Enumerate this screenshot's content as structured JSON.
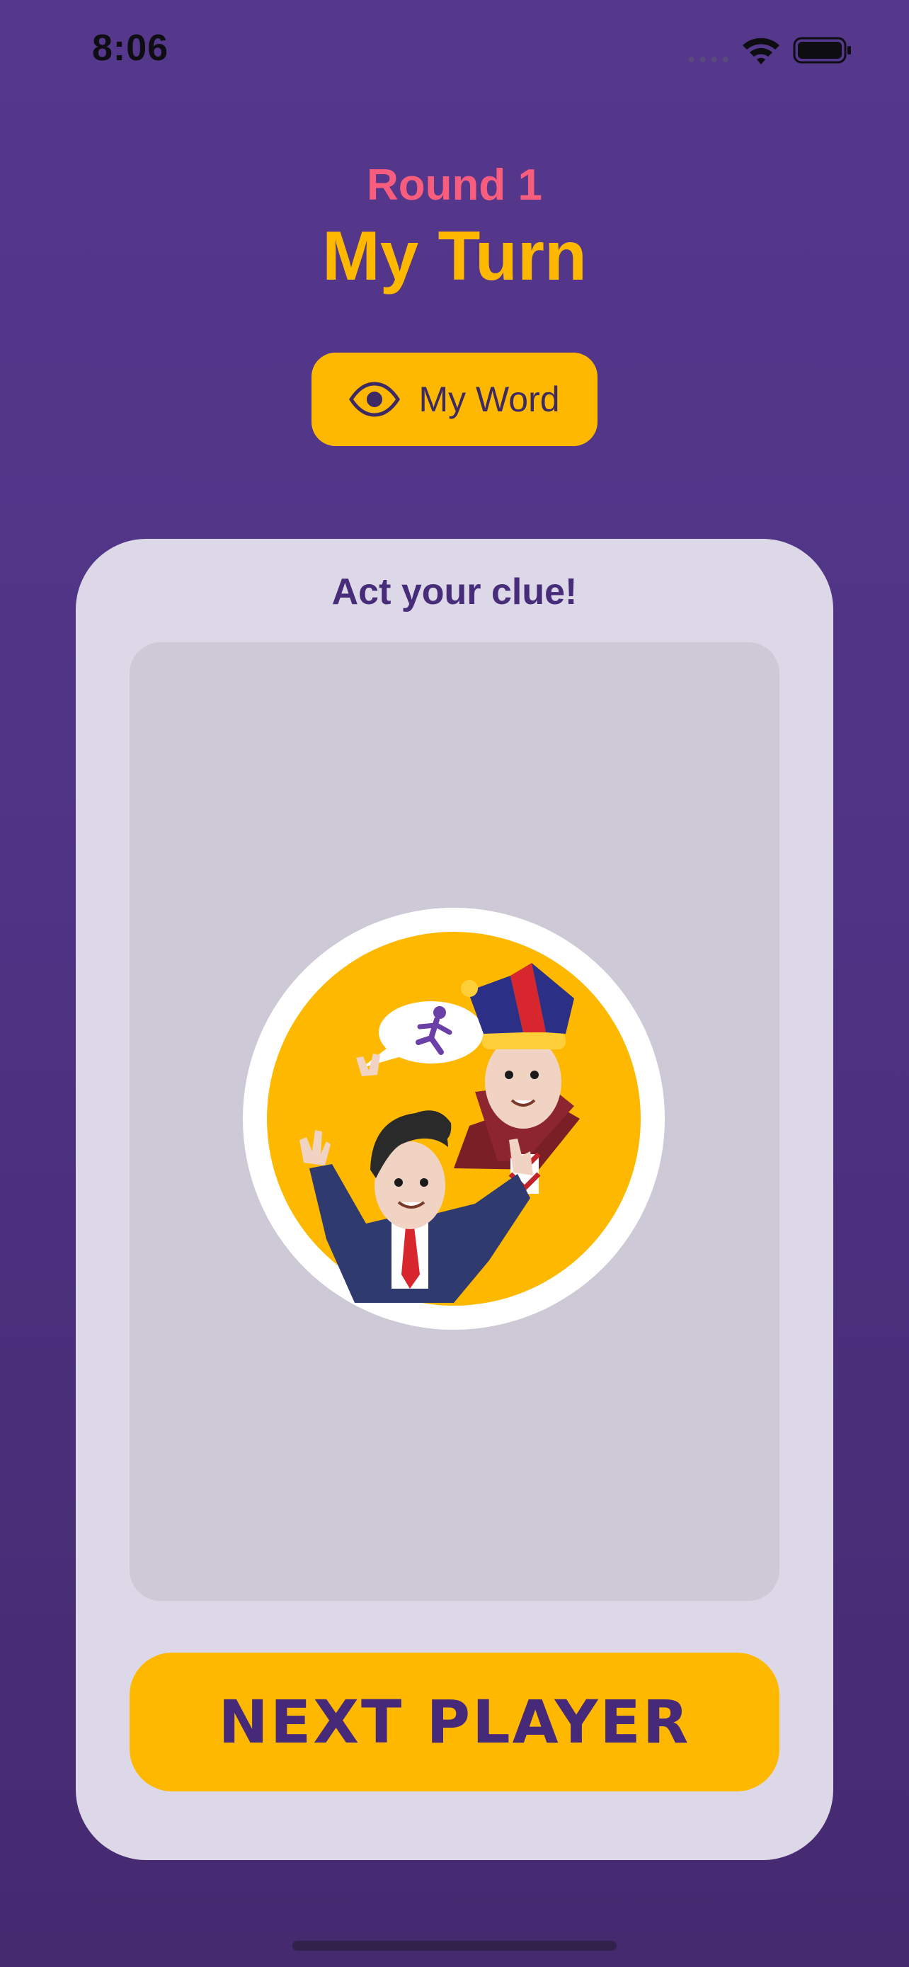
{
  "status_bar": {
    "time": "8:06",
    "icons": [
      "signal-dots-icon",
      "wifi-icon",
      "battery-icon"
    ]
  },
  "header": {
    "round_label": "Round 1",
    "title": "My Turn"
  },
  "my_word_button": {
    "label": "My Word",
    "icon": "eye-icon"
  },
  "card": {
    "instruction": "Act your clue!",
    "illustration": "charades-players-illustration",
    "next_button_label": "NEXT PLAYER"
  },
  "colors": {
    "background": "#55388c",
    "accent": "#ffb800",
    "round_label": "#f85d7e",
    "card": "#ddd8e7",
    "media_area": "#cdc9d6",
    "text_dark_purple": "#47297a"
  }
}
